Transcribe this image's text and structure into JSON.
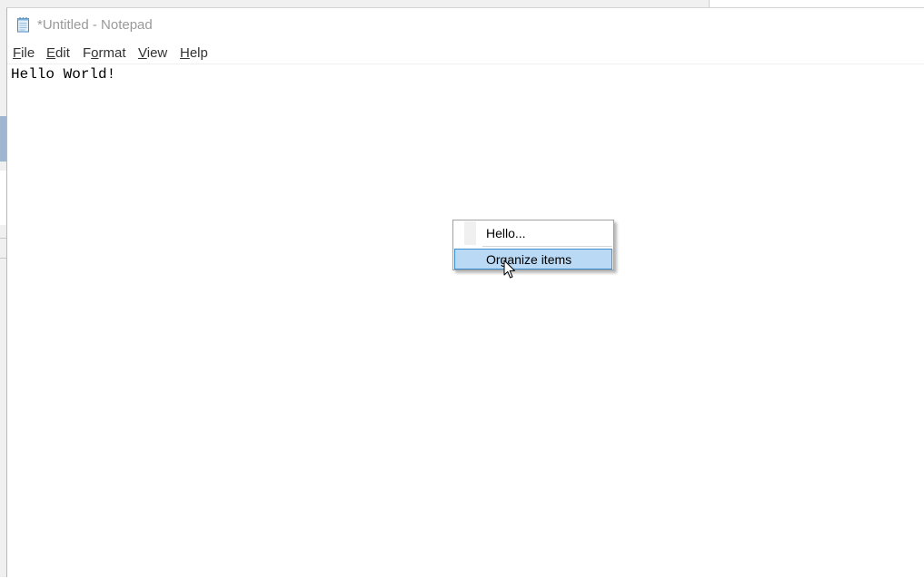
{
  "window": {
    "title": "*Untitled - Notepad",
    "icon": "notepad-icon"
  },
  "menubar": {
    "items": [
      {
        "label": "File",
        "accel": "F",
        "rest": "ile"
      },
      {
        "label": "Edit",
        "accel": "E",
        "rest": "dit"
      },
      {
        "label": "Format",
        "pre": "F",
        "accel": "o",
        "rest": "rmat"
      },
      {
        "label": "View",
        "accel": "V",
        "rest": "iew"
      },
      {
        "label": "Help",
        "accel": "H",
        "rest": "elp"
      }
    ]
  },
  "editor": {
    "content": "Hello World!"
  },
  "context_menu": {
    "items": [
      {
        "label": "Hello..."
      },
      {
        "label": "Organize items",
        "highlighted": true
      }
    ]
  },
  "colors": {
    "highlight_fill": "#b9d9f5",
    "highlight_border": "#3c8cd0",
    "title_text": "#9a9a9a"
  }
}
